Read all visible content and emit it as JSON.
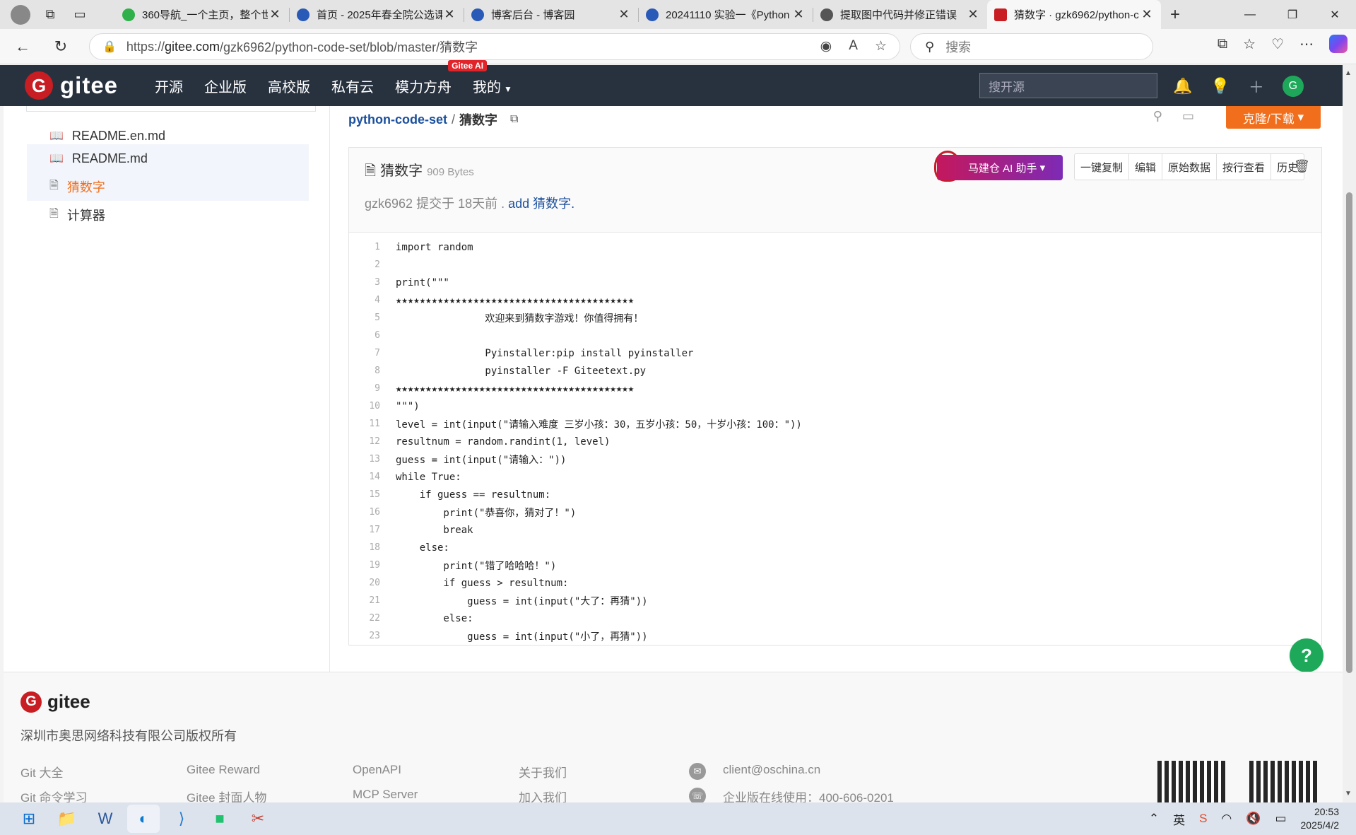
{
  "browser": {
    "tabs": [
      {
        "title": "360导航_一个主页，整个世",
        "color": "#2fb04a"
      },
      {
        "title": "首页 - 2025年春全院公选课",
        "color": "#2a5ab8"
      },
      {
        "title": "博客后台 - 博客园",
        "color": "#2a5ab8"
      },
      {
        "title": "20241110 实验一《Python",
        "color": "#2a5ab8"
      },
      {
        "title": "提取图中代码并修正错误",
        "color": "#555555"
      },
      {
        "title": "猜数字 · gzk6962/python-c",
        "color": "#c71d23"
      }
    ],
    "url_prefix": "https://",
    "url_host": "gitee.com",
    "url_path": "/gzk6962/python-code-set/blob/master/猜数字",
    "search_placeholder": "搜索"
  },
  "gitee": {
    "logo_text": "gitee",
    "nav": [
      "开源",
      "企业版",
      "高校版",
      "私有云",
      "模力方舟",
      "我的"
    ],
    "nav_badge": "Gitee AI",
    "search_placeholder": "搜开源",
    "avatar_letter": "G"
  },
  "sidebar": {
    "items": [
      {
        "label": "README.en.md"
      },
      {
        "label": "README.md"
      },
      {
        "label": "猜数字"
      },
      {
        "label": "计算器"
      }
    ]
  },
  "file": {
    "repo": "python-code-set",
    "sep": "/",
    "name": "猜数字",
    "size": "909 Bytes",
    "clone_label": "克隆/下载",
    "ai_label": "马建仓 AI 助手",
    "buttons": [
      "一键复制",
      "编辑",
      "原始数据",
      "按行查看",
      "历史"
    ],
    "commit_author": "gzk6962",
    "commit_text": "提交于 18天前 .",
    "commit_msg": "add 猜数字.",
    "lines": [
      {
        "n": "1",
        "code": "import random"
      },
      {
        "n": "2",
        "code": ""
      },
      {
        "n": "3",
        "code": "print(\"\"\""
      },
      {
        "n": "4",
        "code": "★★★★★★★★★★★★★★★★★★★★★★★★★★★★★★★★★★★★★★★★"
      },
      {
        "n": "5",
        "code": "               欢迎来到猜数字游戏！你值得拥有！"
      },
      {
        "n": "6",
        "code": ""
      },
      {
        "n": "7",
        "code": "               Pyinstaller:pip install pyinstaller"
      },
      {
        "n": "8",
        "code": "               pyinstaller -F Giteetext.py"
      },
      {
        "n": "9",
        "code": "★★★★★★★★★★★★★★★★★★★★★★★★★★★★★★★★★★★★★★★★"
      },
      {
        "n": "10",
        "code": "\"\"\")"
      },
      {
        "n": "11",
        "code": "level = int(input(\"请输入难度 三岁小孩：30，五岁小孩：50，十岁小孩：100：\"))"
      },
      {
        "n": "12",
        "code": "resultnum = random.randint(1, level)"
      },
      {
        "n": "13",
        "code": "guess = int(input(\"请输入：\"))"
      },
      {
        "n": "14",
        "code": "while True:"
      },
      {
        "n": "15",
        "code": "    if guess == resultnum:"
      },
      {
        "n": "16",
        "code": "        print(\"恭喜你，猜对了！\")"
      },
      {
        "n": "17",
        "code": "        break"
      },
      {
        "n": "18",
        "code": "    else:"
      },
      {
        "n": "19",
        "code": "        print(\"错了哈哈哈！\")"
      },
      {
        "n": "20",
        "code": "        if guess > resultnum:"
      },
      {
        "n": "21",
        "code": "            guess = int(input(\"大了：再猜\"))"
      },
      {
        "n": "22",
        "code": "        else:"
      },
      {
        "n": "23",
        "code": "            guess = int(input(\"小了，再猜\"))"
      }
    ]
  },
  "floaters": {
    "help": "?"
  },
  "footer": {
    "logo_text": "gitee",
    "copyright": "深圳市奥思网络科技有限公司版权所有",
    "col1": [
      "Git 大全",
      "Git 命令学习"
    ],
    "col2": [
      "Gitee Reward",
      "Gitee 封面人物"
    ],
    "col3": [
      "OpenAPI",
      "MCP Server"
    ],
    "col4": [
      "关于我们",
      "加入我们"
    ],
    "email": "client@oschina.cn",
    "phone": "企业版在线使用：400-606-0201"
  },
  "taskbar": {
    "ime": "英",
    "time": "20:53",
    "date": "2025/4/2"
  },
  "colors": {
    "gitee_red": "#c71d23",
    "header_bg": "#28323f",
    "accent_orange": "#f06e1c",
    "link_blue": "#1a4f9c"
  }
}
